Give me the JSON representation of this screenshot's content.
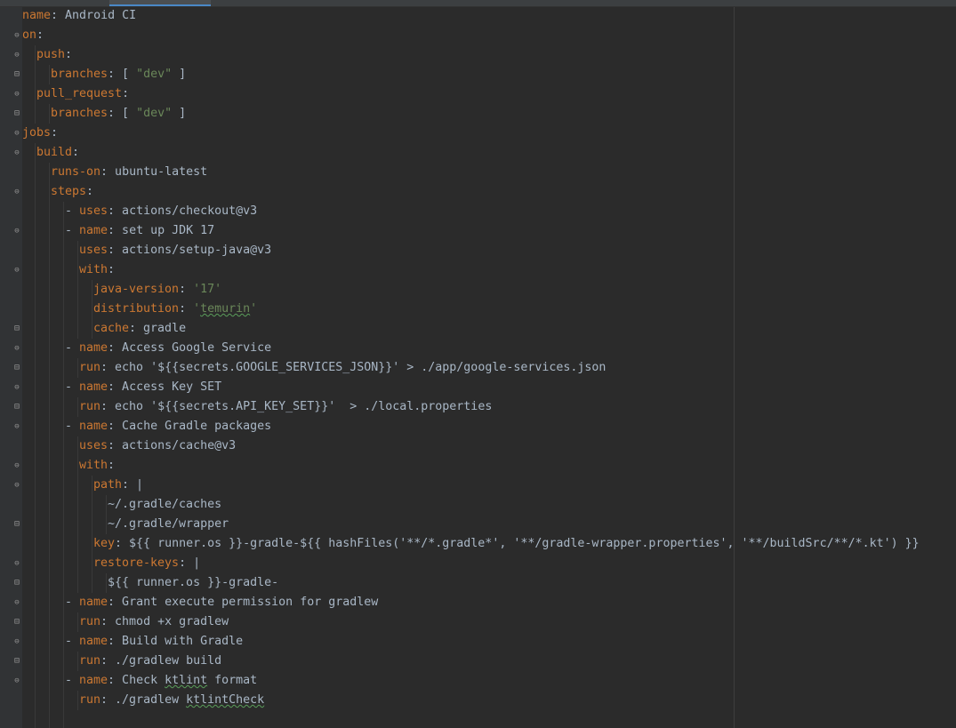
{
  "editor": {
    "tabs": [
      "",
      "",
      "",
      "",
      "",
      "",
      ""
    ],
    "lines": [
      {
        "n": 1,
        "indent": 0,
        "fold": "none",
        "parts": [
          {
            "t": "k",
            "v": "name"
          },
          {
            "t": "p",
            "v": ": Android CI"
          }
        ]
      },
      {
        "n": 2,
        "indent": 0,
        "fold": "open",
        "parts": [
          {
            "t": "k",
            "v": "on"
          },
          {
            "t": "p",
            "v": ":"
          }
        ]
      },
      {
        "n": 3,
        "indent": 1,
        "fold": "open",
        "parts": [
          {
            "t": "k",
            "v": "push"
          },
          {
            "t": "p",
            "v": ":"
          }
        ]
      },
      {
        "n": 4,
        "indent": 2,
        "fold": "close",
        "parts": [
          {
            "t": "k",
            "v": "branches"
          },
          {
            "t": "p",
            "v": ": [ "
          },
          {
            "t": "s",
            "v": "\"dev\""
          },
          {
            "t": "p",
            "v": " ]"
          }
        ]
      },
      {
        "n": 5,
        "indent": 1,
        "fold": "open",
        "parts": [
          {
            "t": "k",
            "v": "pull_request"
          },
          {
            "t": "p",
            "v": ":"
          }
        ]
      },
      {
        "n": 6,
        "indent": 2,
        "fold": "close",
        "parts": [
          {
            "t": "k",
            "v": "branches"
          },
          {
            "t": "p",
            "v": ": [ "
          },
          {
            "t": "s",
            "v": "\"dev\""
          },
          {
            "t": "p",
            "v": " ]"
          }
        ]
      },
      {
        "n": 7,
        "indent": 0,
        "fold": "open",
        "parts": [
          {
            "t": "k",
            "v": "jobs"
          },
          {
            "t": "p",
            "v": ":"
          }
        ]
      },
      {
        "n": 8,
        "indent": 1,
        "fold": "open",
        "parts": [
          {
            "t": "k",
            "v": "build"
          },
          {
            "t": "p",
            "v": ":"
          }
        ]
      },
      {
        "n": 9,
        "indent": 2,
        "fold": "none",
        "parts": [
          {
            "t": "k",
            "v": "runs-on"
          },
          {
            "t": "p",
            "v": ": ubuntu-latest"
          }
        ]
      },
      {
        "n": 10,
        "indent": 2,
        "fold": "open",
        "parts": [
          {
            "t": "k",
            "v": "steps"
          },
          {
            "t": "p",
            "v": ":"
          }
        ]
      },
      {
        "n": 11,
        "indent": 3,
        "fold": "none",
        "parts": [
          {
            "t": "p",
            "v": "- "
          },
          {
            "t": "k",
            "v": "uses"
          },
          {
            "t": "p",
            "v": ": actions/checkout@v3"
          }
        ]
      },
      {
        "n": 12,
        "indent": 3,
        "fold": "open",
        "parts": [
          {
            "t": "p",
            "v": "- "
          },
          {
            "t": "k",
            "v": "name"
          },
          {
            "t": "p",
            "v": ": set up JDK 17"
          }
        ]
      },
      {
        "n": 13,
        "indent": 4,
        "fold": "none",
        "parts": [
          {
            "t": "k",
            "v": "uses"
          },
          {
            "t": "p",
            "v": ": actions/setup-java@v3"
          }
        ]
      },
      {
        "n": 14,
        "indent": 4,
        "fold": "open",
        "parts": [
          {
            "t": "k",
            "v": "with"
          },
          {
            "t": "p",
            "v": ":"
          }
        ]
      },
      {
        "n": 15,
        "indent": 5,
        "fold": "none",
        "parts": [
          {
            "t": "k",
            "v": "java-version"
          },
          {
            "t": "p",
            "v": ": "
          },
          {
            "t": "s",
            "v": "'17'"
          }
        ]
      },
      {
        "n": 16,
        "indent": 5,
        "fold": "none",
        "parts": [
          {
            "t": "k",
            "v": "distribution"
          },
          {
            "t": "p",
            "v": ": "
          },
          {
            "t": "s",
            "v": "'"
          },
          {
            "t": "su",
            "v": "temurin"
          },
          {
            "t": "s",
            "v": "'"
          }
        ]
      },
      {
        "n": 17,
        "indent": 5,
        "fold": "close",
        "parts": [
          {
            "t": "k",
            "v": "cache"
          },
          {
            "t": "p",
            "v": ": gradle"
          }
        ]
      },
      {
        "n": 18,
        "indent": 3,
        "fold": "open",
        "parts": [
          {
            "t": "p",
            "v": "- "
          },
          {
            "t": "k",
            "v": "name"
          },
          {
            "t": "p",
            "v": ": Access Google Service"
          }
        ]
      },
      {
        "n": 19,
        "indent": 4,
        "fold": "close",
        "parts": [
          {
            "t": "k",
            "v": "run"
          },
          {
            "t": "p",
            "v": ": echo '${{secrets.GOOGLE_SERVICES_JSON}}' > ./app/google-services.json"
          }
        ]
      },
      {
        "n": 20,
        "indent": 3,
        "fold": "open",
        "parts": [
          {
            "t": "p",
            "v": "- "
          },
          {
            "t": "k",
            "v": "name"
          },
          {
            "t": "p",
            "v": ": Access Key SET"
          }
        ]
      },
      {
        "n": 21,
        "indent": 4,
        "fold": "close",
        "parts": [
          {
            "t": "k",
            "v": "run"
          },
          {
            "t": "p",
            "v": ": echo '${{secrets.API_KEY_SET}}'  > ./local.properties"
          }
        ]
      },
      {
        "n": 22,
        "indent": 3,
        "fold": "open",
        "parts": [
          {
            "t": "p",
            "v": "- "
          },
          {
            "t": "k",
            "v": "name"
          },
          {
            "t": "p",
            "v": ": Cache Gradle packages"
          }
        ]
      },
      {
        "n": 23,
        "indent": 4,
        "fold": "none",
        "parts": [
          {
            "t": "k",
            "v": "uses"
          },
          {
            "t": "p",
            "v": ": actions/cache@v3"
          }
        ]
      },
      {
        "n": 24,
        "indent": 4,
        "fold": "open",
        "parts": [
          {
            "t": "k",
            "v": "with"
          },
          {
            "t": "p",
            "v": ":"
          }
        ]
      },
      {
        "n": 25,
        "indent": 5,
        "fold": "open",
        "parts": [
          {
            "t": "k",
            "v": "path"
          },
          {
            "t": "p",
            "v": ": |"
          }
        ]
      },
      {
        "n": 26,
        "indent": 6,
        "fold": "none",
        "parts": [
          {
            "t": "p",
            "v": "~/.gradle/caches"
          }
        ]
      },
      {
        "n": 27,
        "indent": 6,
        "fold": "close",
        "parts": [
          {
            "t": "p",
            "v": "~/.gradle/wrapper"
          }
        ]
      },
      {
        "n": 28,
        "indent": 5,
        "fold": "none",
        "parts": [
          {
            "t": "k",
            "v": "key"
          },
          {
            "t": "p",
            "v": ": ${{ runner.os }}-gradle-${{ hashFiles('**/*.gradle*', '**/gradle-wrapper.properties', '**/buildSrc/**/*.kt') }}"
          }
        ]
      },
      {
        "n": 29,
        "indent": 5,
        "fold": "open",
        "parts": [
          {
            "t": "k",
            "v": "restore-keys"
          },
          {
            "t": "p",
            "v": ": |"
          }
        ]
      },
      {
        "n": 30,
        "indent": 6,
        "fold": "close",
        "parts": [
          {
            "t": "p",
            "v": "${{ runner.os }}-gradle-"
          }
        ]
      },
      {
        "n": 31,
        "indent": 3,
        "fold": "open",
        "parts": [
          {
            "t": "p",
            "v": "- "
          },
          {
            "t": "k",
            "v": "name"
          },
          {
            "t": "p",
            "v": ": Grant execute permission for gradlew"
          }
        ]
      },
      {
        "n": 32,
        "indent": 4,
        "fold": "close",
        "parts": [
          {
            "t": "k",
            "v": "run"
          },
          {
            "t": "p",
            "v": ": chmod +x gradlew"
          }
        ]
      },
      {
        "n": 33,
        "indent": 3,
        "fold": "open",
        "parts": [
          {
            "t": "p",
            "v": "- "
          },
          {
            "t": "k",
            "v": "name"
          },
          {
            "t": "p",
            "v": ": Build with Gradle"
          }
        ]
      },
      {
        "n": 34,
        "indent": 4,
        "fold": "close",
        "parts": [
          {
            "t": "k",
            "v": "run"
          },
          {
            "t": "p",
            "v": ": ./gradlew build"
          }
        ]
      },
      {
        "n": 35,
        "indent": 3,
        "fold": "open",
        "parts": [
          {
            "t": "p",
            "v": "- "
          },
          {
            "t": "k",
            "v": "name"
          },
          {
            "t": "p",
            "v": ": Check "
          },
          {
            "t": "pu",
            "v": "ktlint"
          },
          {
            "t": "p",
            "v": " format"
          }
        ]
      },
      {
        "n": 36,
        "indent": 4,
        "fold": "none",
        "parts": [
          {
            "t": "k",
            "v": "run"
          },
          {
            "t": "p",
            "v": ": ./gradlew "
          },
          {
            "t": "pu",
            "v": "ktlintCheck"
          }
        ]
      },
      {
        "n": 37,
        "indent": 3,
        "fold": "none",
        "parts": []
      }
    ]
  },
  "colors": {
    "background": "#2b2b2b",
    "key": "#cc7832",
    "string": "#6a8759",
    "plain": "#a9b7c6"
  },
  "icons": [
    "fold-open-icon",
    "fold-close-icon"
  ]
}
